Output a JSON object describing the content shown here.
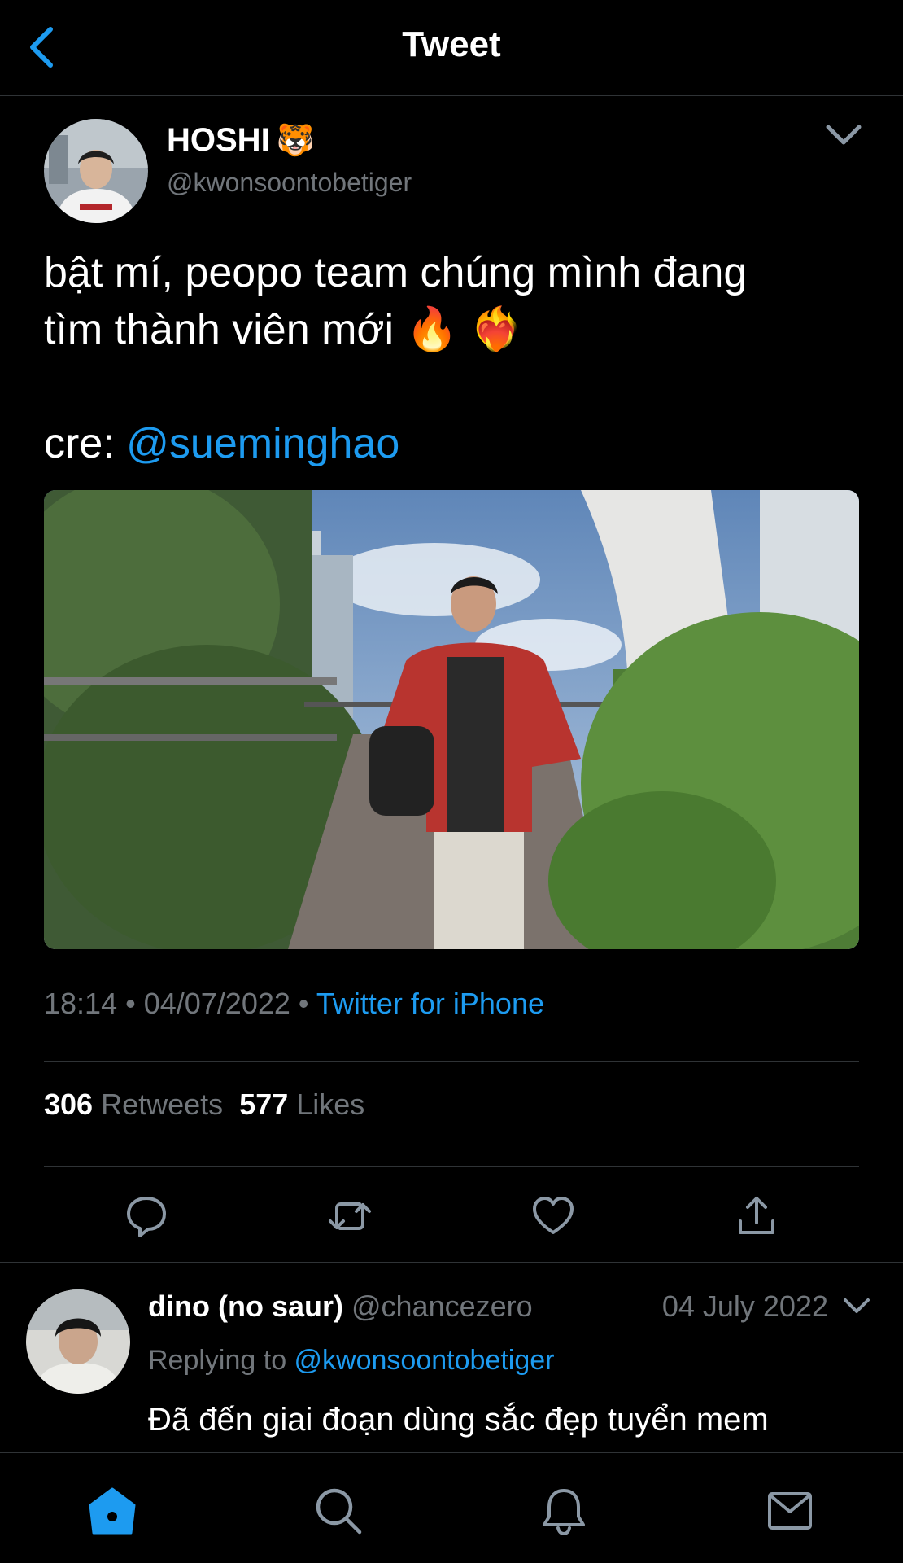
{
  "header": {
    "title": "Tweet"
  },
  "tweet": {
    "author_name": "HOSHI",
    "author_emoji": "🐯",
    "author_handle": "@kwonsoontobetiger",
    "text": "bật mí, peopo team chúng mình đang\ntìm thành viên mới 🔥 ❤️‍🔥",
    "credit_prefix": "cre: ",
    "credit_mention": "@sueminghao",
    "time": "18:14",
    "date": "04/07/2022",
    "separator": " • ",
    "source": "Twitter for iPhone",
    "retweets_count": "306",
    "retweets_label": "Retweets",
    "likes_count": "577",
    "likes_label": "Likes"
  },
  "reply": {
    "name": "dino (no saur)",
    "handle": "@chancezero",
    "date": "04 July 2022",
    "replying_prefix": "Replying to ",
    "replying_handle": "@kwonsoontobetiger",
    "text": "Đã đến giai đoạn dùng sắc đẹp tuyển mem"
  },
  "colors": {
    "accent": "#1d9bf0",
    "muted": "#71767b",
    "background": "#000000",
    "divider": "#2f3336"
  },
  "icons": [
    "back-icon",
    "chevron-down-icon",
    "reply-icon",
    "retweet-icon",
    "like-icon",
    "share-icon",
    "home-icon",
    "search-icon",
    "notifications-icon",
    "messages-icon"
  ]
}
